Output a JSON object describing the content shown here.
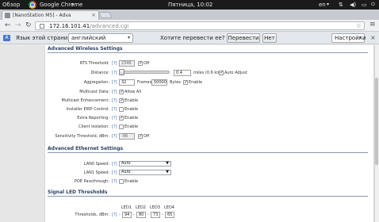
{
  "topbar": {
    "overview": "Обзор",
    "app_name": "Google Chrome",
    "clock": "Пятница, 10:02",
    "lang": "en"
  },
  "tab": {
    "title": "[NanoStation M5] - Adva"
  },
  "omnibox": {
    "host": "172.16.101.41",
    "path": "/advanced.cgi"
  },
  "translate": {
    "prompt": "Язык этой страницы",
    "language": "английский",
    "question": "Хотите перевести ее?",
    "translate_button": "Перевести",
    "no_button": "Нет",
    "settings_button": "Настройки"
  },
  "wireless": {
    "header": "Advanced Wireless Settings",
    "help": "[?]",
    "rts_label": "RTS Threshold:",
    "rts_value": "2346",
    "rts_off_label": "Off",
    "distance_label": "Distance:",
    "distance_value": "0.4",
    "distance_unit": "miles (0.6 km)",
    "auto_adjust_label": "Auto Adjust",
    "aggregation_label": "Aggregation:",
    "aggregation_frames": "32",
    "frames_label": "Frames",
    "aggregation_bytes": "50000",
    "bytes_label": "Bytes",
    "enable_label": "Enable",
    "multicast_data_label": "Multicast Data:",
    "allow_all_label": "Allow All",
    "multicast_enh_label": "Multicast Enhancement:",
    "installer_eirp_label": "Installer EIRP Control:",
    "extra_reporting_label": "Extra Reporting:",
    "client_isolation_label": "Client Isolation:",
    "sensitivity_label": "Sensitivity Threshold, dBm:",
    "sensitivity_value": "-96",
    "sensitivity_off_label": "Off"
  },
  "ethernet": {
    "header": "Advanced Ethernet Settings",
    "lan0_label": "LAN0 Speed:",
    "lan0_value": "Auto",
    "lan1_label": "LAN1 Speed:",
    "lan1_value": "Auto",
    "poe_label": "POE Passthrough:",
    "poe_enable_label": "Enable"
  },
  "signal_led": {
    "header": "Signal LED Thresholds",
    "led_headers": [
      "LED1",
      "LED2",
      "LED3",
      "LED4"
    ],
    "thresholds_label": "Thresholds, dBm:",
    "values": [
      "94",
      "80",
      "73",
      "65"
    ]
  }
}
